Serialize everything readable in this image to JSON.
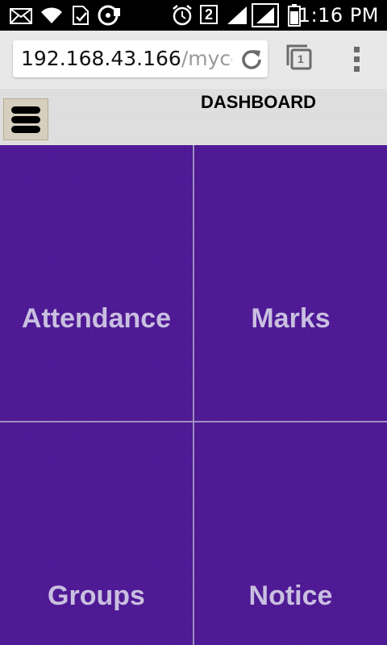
{
  "status_bar": {
    "notification_count": "2",
    "time": "1:16 PM"
  },
  "browser": {
    "url_host": "192.168.43.166",
    "url_path": "/mycc",
    "tab_count": "1"
  },
  "header": {
    "title": "DASHBOARD"
  },
  "tiles": [
    {
      "label": "Attendance"
    },
    {
      "label": "Marks"
    },
    {
      "label": "Groups"
    },
    {
      "label": "Notice"
    }
  ],
  "colors": {
    "tile_background": "#521b9a",
    "tile_text": "#c9bfe0",
    "header_background": "#dcdcdc"
  }
}
